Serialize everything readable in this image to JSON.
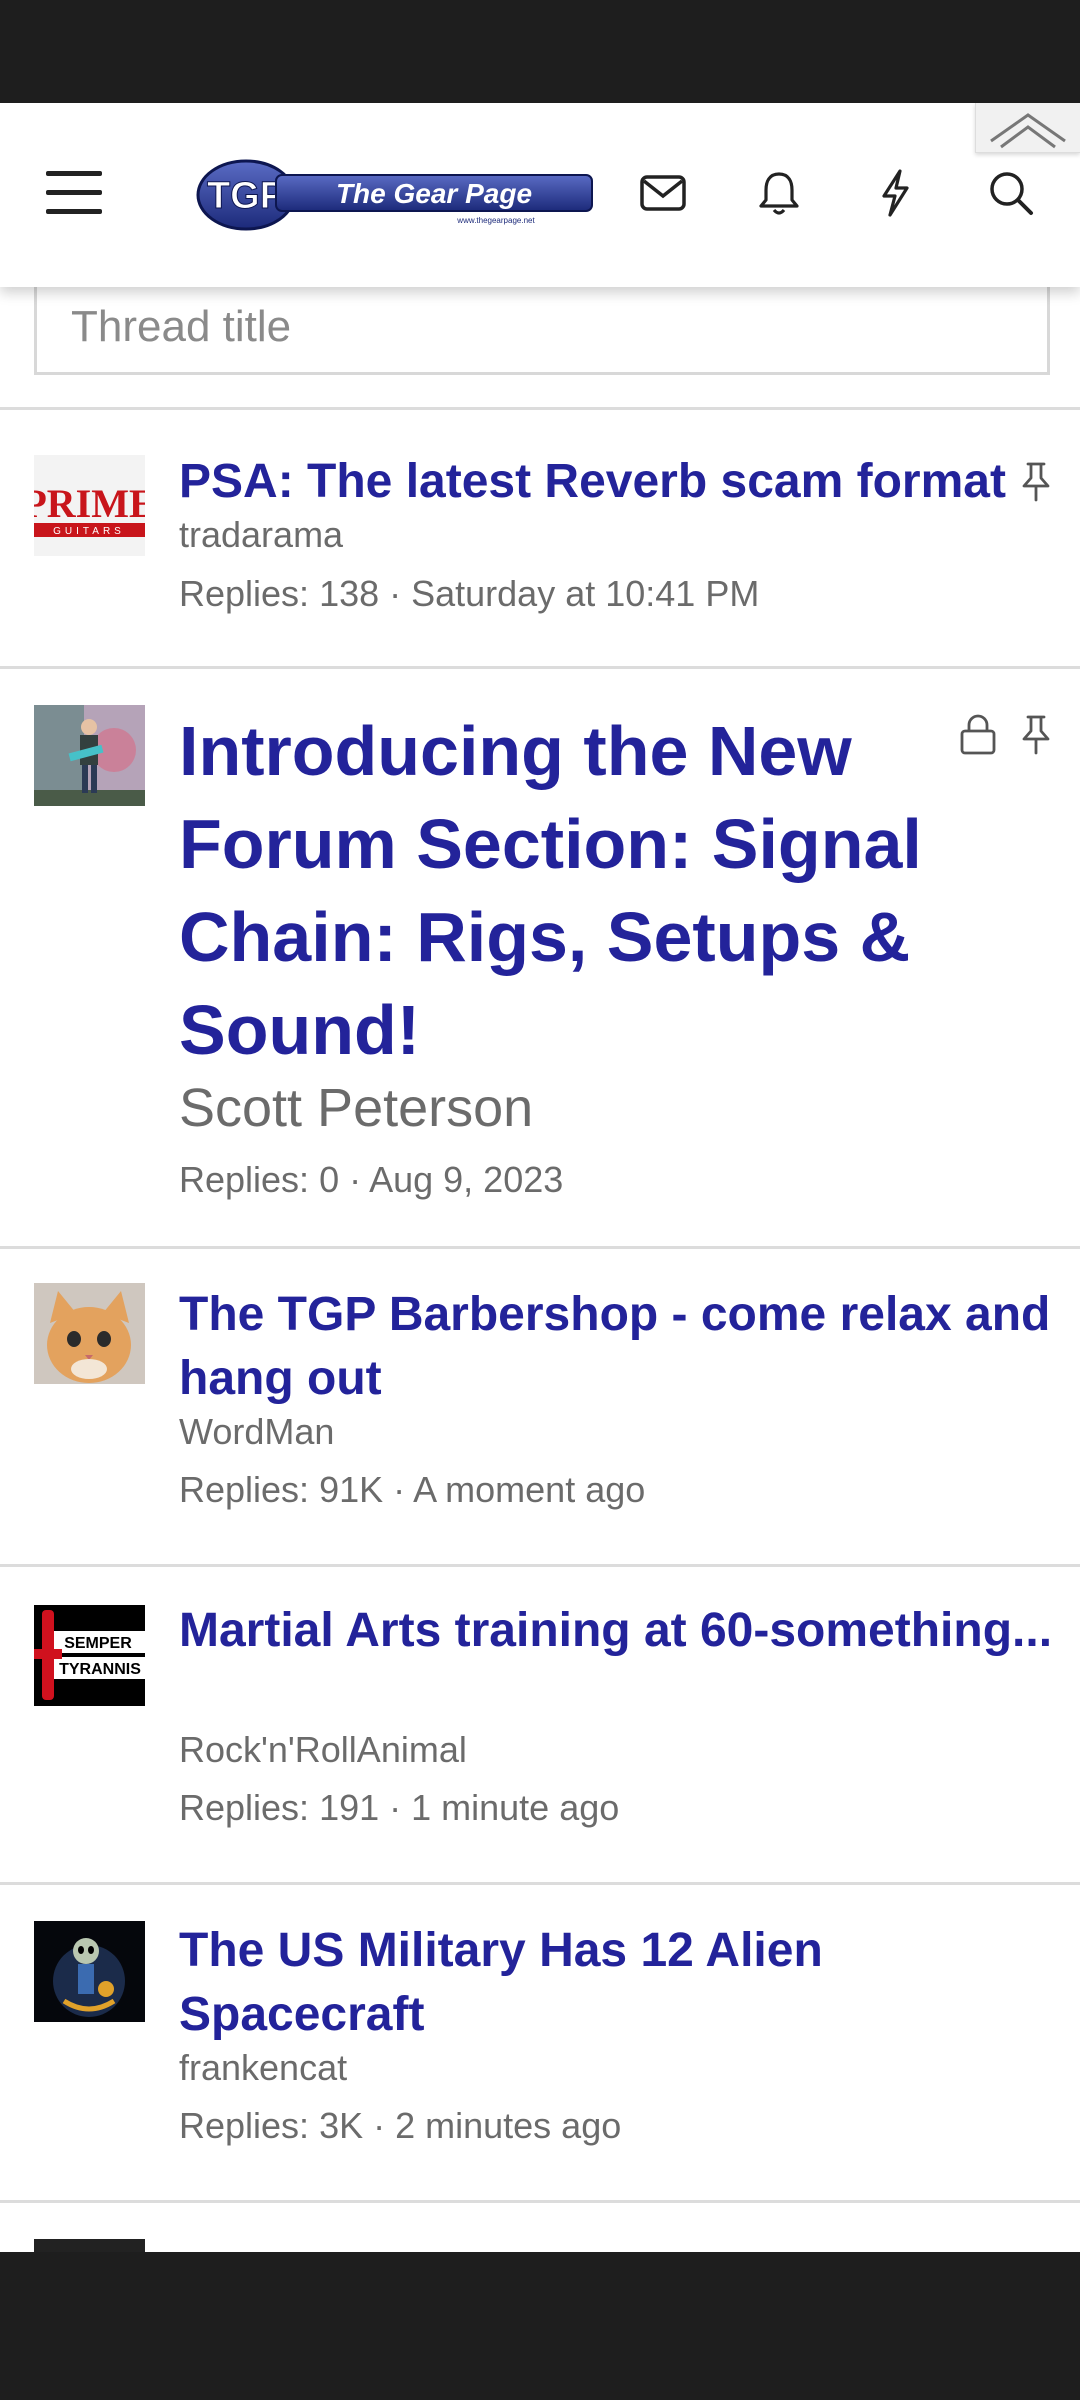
{
  "header": {
    "logo_text": "The Gear Page",
    "logo_short": "TGP",
    "logo_url_text": "www.thegearpage.net"
  },
  "form": {
    "title_placeholder": "Thread title"
  },
  "threads": [
    {
      "title": "PSA: The latest Reverb scam format",
      "author": "tradarama",
      "meta": "Replies: 138 · Saturday at 10:41 PM",
      "avatar_text": "PRIME",
      "avatar_subtext": "GUITARS",
      "pinned": true,
      "locked": false
    },
    {
      "title": "Introducing the New Forum Section: Signal Chain: Rigs, Setups & Sound!",
      "author": "Scott Peterson",
      "meta": "Replies: 0 · Aug 9, 2023",
      "pinned": true,
      "locked": true
    },
    {
      "title": "The TGP Barbershop - come relax and hang out",
      "author": "WordMan",
      "meta": "Replies: 91K · A moment ago"
    },
    {
      "title": "Martial Arts training at 60-something...",
      "author": "Rock'n'RollAnimal",
      "meta": "Replies: 191 · 1 minute ago",
      "avatar_text_1": "SEMPER",
      "avatar_text_2": "TYRANNIS"
    },
    {
      "title": "The US Military Has 12 Alien Spacecraft",
      "author": "frankencat",
      "meta": "Replies: 3K · 2 minutes ago"
    }
  ],
  "colors": {
    "link": "#23239a",
    "muted": "#6b6b6b",
    "divider": "#dcdcdc"
  }
}
